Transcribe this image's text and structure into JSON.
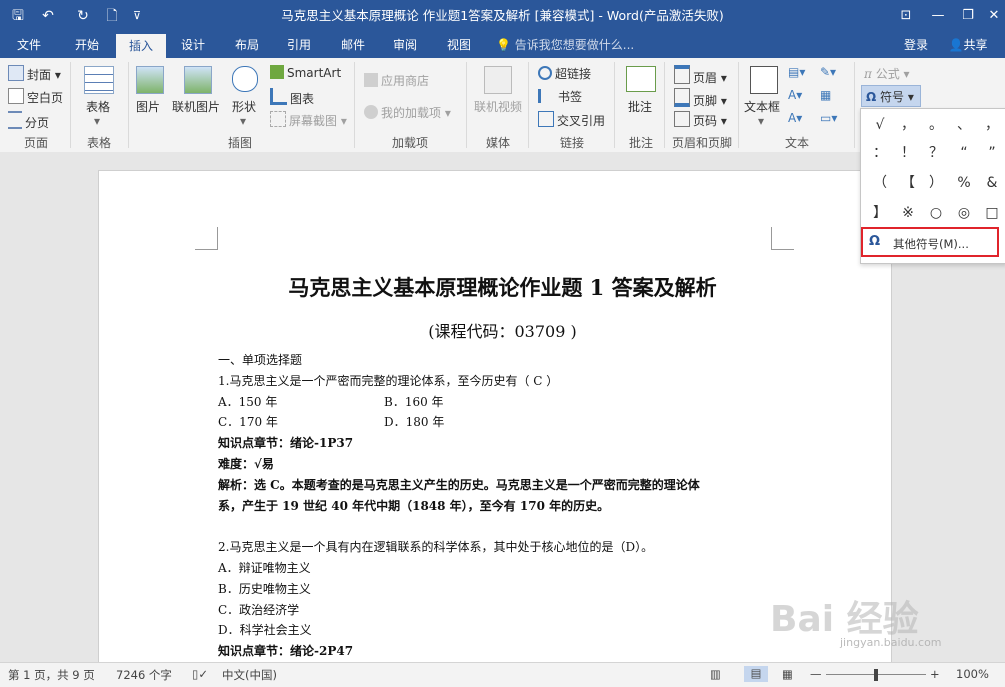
{
  "window": {
    "title": "马克思主义基本原理概论  作业题1答案及解析 [兼容模式] - Word(产品激活失败)",
    "minimize": "—",
    "restore": "❐",
    "close": "✕",
    "ribbon_display": "⊡"
  },
  "quick_access": {
    "save": "🖫",
    "undo": "↶",
    "redo": "↻",
    "new": "🗋",
    "customize": "⊽"
  },
  "tabs": [
    "文件",
    "开始",
    "插入",
    "设计",
    "布局",
    "引用",
    "邮件",
    "审阅",
    "视图"
  ],
  "active_tab": "插入",
  "tell_me": "告诉我您想要做什么...",
  "login": "登录",
  "share": "共享",
  "ribbon": {
    "pages": {
      "cover": "封面",
      "blank": "空白页",
      "break": "分页",
      "group": "页面"
    },
    "tables": {
      "table": "表格",
      "group": "表格"
    },
    "illustrations": {
      "picture": "图片",
      "online_picture": "联机图片",
      "shapes": "形状",
      "smartart": "SmartArt",
      "chart": "图表",
      "screenshot": "屏幕截图",
      "group": "插图"
    },
    "addins": {
      "store": "应用商店",
      "my_addins": "我的加载项",
      "group": "加载项"
    },
    "media": {
      "online_video": "联机视频",
      "group": "媒体"
    },
    "links": {
      "hyperlink": "超链接",
      "bookmark": "书签",
      "cross_ref": "交叉引用",
      "group": "链接"
    },
    "comments": {
      "comment": "批注",
      "group": "批注"
    },
    "header_footer": {
      "header": "页眉",
      "footer": "页脚",
      "page_number": "页码",
      "group": "页眉和页脚"
    },
    "text": {
      "textbox": "文本框",
      "group": "文本"
    },
    "symbols": {
      "equation": "公式",
      "symbol": "符号"
    }
  },
  "symbol_grid": [
    [
      "√",
      "，",
      "。",
      "、",
      "，"
    ],
    [
      "：",
      "！",
      "？",
      "“",
      "”"
    ],
    [
      "（",
      "【",
      "）",
      "%",
      "&"
    ],
    [
      "】",
      "※",
      "○",
      "◎",
      "□"
    ]
  ],
  "more_symbols": "其他符号(M)...",
  "document": {
    "title_part1": "马克思主义基本原理概论",
    "title_part2": "作业题 1 答案及解析",
    "subtitle": "(课程代码：03709  )",
    "lines": [
      {
        "text": "一、单项选择题",
        "bold": false
      },
      {
        "text": "1.马克思主义是一个严密而完整的理论体系，至今历史有（  C      ）",
        "bold": false
      },
      {
        "text": "A．150 年",
        "bold": false
      },
      {
        "text": "C．170 年",
        "bold": false
      },
      {
        "text": "知识点章节：绪论-1P37",
        "bold": true
      },
      {
        "text": "难度：√易",
        "bold": true
      },
      {
        "text": "解析：选 C。本题考查的是马克思主义产生的历史。马克思主义是一个严密而完整的理论体",
        "bold": true
      },
      {
        "text": "系，产生于 19 世纪 40 年代中期（1848 年），至今有 170 年的历史。",
        "bold": true
      },
      {
        "text": "",
        "bold": false
      },
      {
        "text": "2.马克思主义是一个具有内在逻辑联系的科学体系，其中处于核心地位的是（D）。",
        "bold": false
      },
      {
        "text": "A．辩证唯物主义",
        "bold": false
      },
      {
        "text": "B．历史唯物主义",
        "bold": false
      },
      {
        "text": "C．政治经济学",
        "bold": false
      },
      {
        "text": "D．科学社会主义",
        "bold": false
      },
      {
        "text": "知识点章节：绪论-2P47",
        "bold": true
      }
    ],
    "option_b1": "B．160 年",
    "option_d1": "D．180 年"
  },
  "status": {
    "page": "第 1 页，共 9 页",
    "words": "7246 个字",
    "language": "中文(中国)",
    "zoom": "100%",
    "zoom_minus": "—",
    "zoom_plus": "+"
  },
  "watermark": "Bai 经验",
  "watermark_url": "jingyan.baidu.com",
  "colors": {
    "accent": "#2b579a",
    "highlight": "#e0242b"
  }
}
